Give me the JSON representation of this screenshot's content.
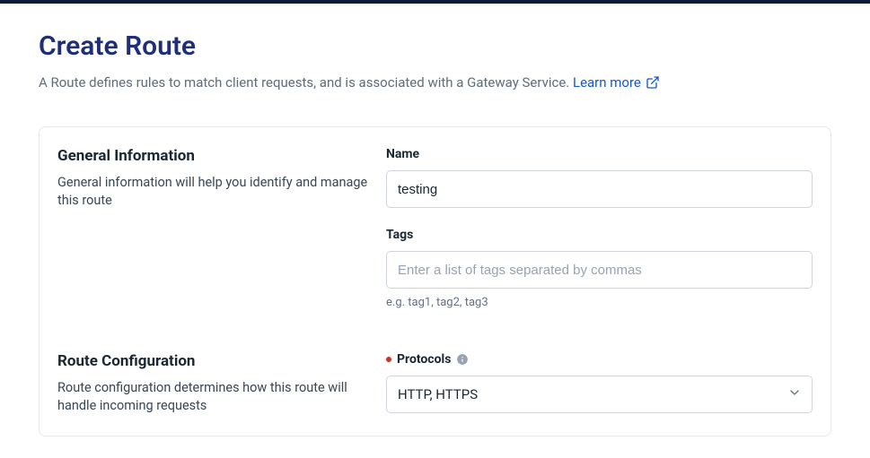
{
  "header": {
    "title": "Create Route",
    "subtitle": "A Route defines rules to match client requests, and is associated with a Gateway Service. ",
    "learn_more": "Learn more"
  },
  "sections": {
    "general": {
      "title": "General Information",
      "desc": "General information will help you identify and manage this route",
      "name_label": "Name",
      "name_value": "testing",
      "tags_label": "Tags",
      "tags_placeholder": "Enter a list of tags separated by commas",
      "tags_helper": "e.g. tag1, tag2, tag3"
    },
    "route_config": {
      "title": "Route Configuration",
      "desc": "Route configuration determines how this route will handle incoming requests",
      "protocols_label": "Protocols",
      "protocols_value": "HTTP, HTTPS"
    }
  }
}
